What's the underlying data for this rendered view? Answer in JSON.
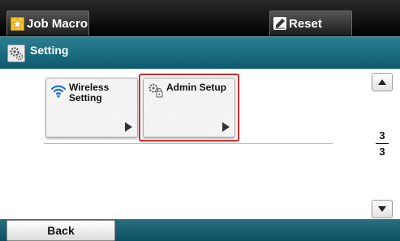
{
  "top_bar": {
    "job_macro_label": "Job Macro",
    "reset_label": "Reset"
  },
  "title_bar": {
    "title": "Setting",
    "icon": "gears-icon"
  },
  "tiles": [
    {
      "label_line1": "Wireless",
      "label_line2": "Setting",
      "icon": "wifi-icon"
    },
    {
      "label_line1": "Admin Setup",
      "label_line2": "",
      "icon": "gears-lock-icon",
      "selected": true
    }
  ],
  "pager": {
    "current": "3",
    "total": "3"
  },
  "bottom_bar": {
    "back_label": "Back"
  },
  "colors": {
    "title_bar": "#1a6b7e",
    "highlight": "#d02a2a",
    "star": "#f3c52a",
    "wifi": "#1e6fd9"
  }
}
